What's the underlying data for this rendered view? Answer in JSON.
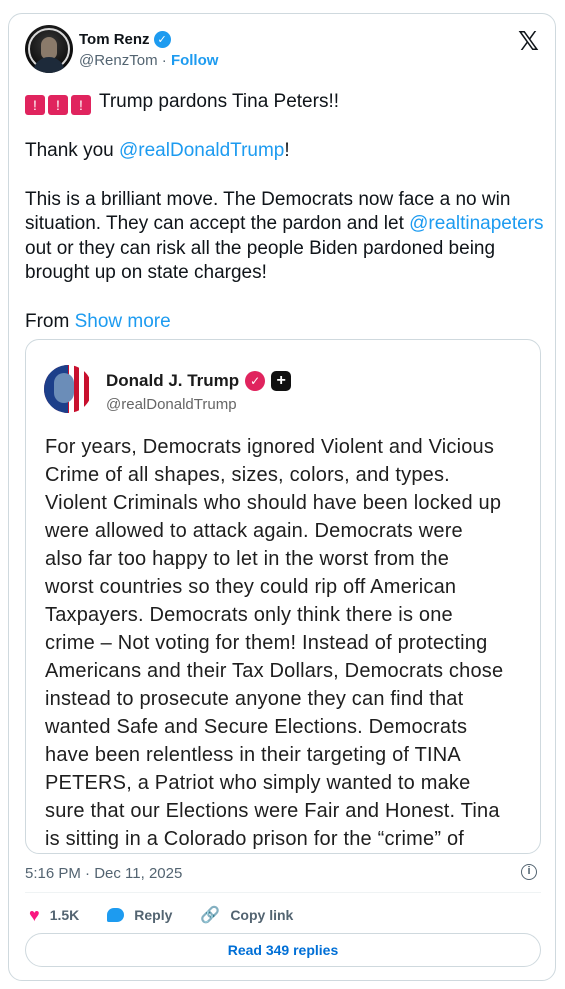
{
  "author": {
    "display_name": "Tom Renz",
    "handle": "@RenzTom",
    "separator": "·",
    "follow_label": "Follow"
  },
  "tweet": {
    "headline": "Trump pardons Tina Peters!!",
    "thanks_prefix": "Thank you ",
    "thanks_mention": "@realDonaldTrump",
    "thanks_suffix": "!",
    "para_a": "This is a brilliant move. The Democrats now face a no win situation. They can accept the pardon and let ",
    "para_mention": "@realtinapeters",
    "para_b": " out or they can risk all the people Biden pardoned being brought up on state charges!",
    "from_label": "From ",
    "show_more": "Show more"
  },
  "quote": {
    "display_name": "Donald J. Trump",
    "handle": "@realDonaldTrump",
    "lines": [
      "For years, Democrats ignored Violent and Vicious",
      "Crime of all shapes, sizes, colors, and types.",
      "Violent Criminals who should have been locked up",
      "were allowed to attack again. Democrats were",
      "also far too happy to let in the worst from the",
      "worst countries so they could rip off American",
      "Taxpayers. Democrats only think there is one",
      "crime – Not voting for them! Instead of protecting",
      "Americans and their Tax Dollars, Democrats chose",
      "instead to prosecute anyone they can find that",
      "wanted Safe and Secure Elections. Democrats",
      "have been relentless in their targeting of TINA",
      "PETERS, a Patriot who simply wanted to make",
      "sure that our Elections were Fair and Honest. Tina",
      "is sitting in a Colorado prison for the “crime” of"
    ]
  },
  "meta": {
    "timestamp": "5:16 PM · Dec 11, 2025"
  },
  "actions": {
    "likes": "1.5K",
    "reply_label": "Reply",
    "copy_link_label": "Copy link",
    "read_replies_label": "Read 349 replies"
  },
  "icons": [
    "verified-badge-icon",
    "x-logo-icon",
    "siren-icon",
    "info-icon",
    "heart-icon",
    "reply-icon",
    "link-icon",
    "plus-badge-icon"
  ],
  "colors": {
    "link": "#1d9bf0",
    "like": "#f91880",
    "siren": "#e0245e",
    "border": "#cfd9de"
  }
}
